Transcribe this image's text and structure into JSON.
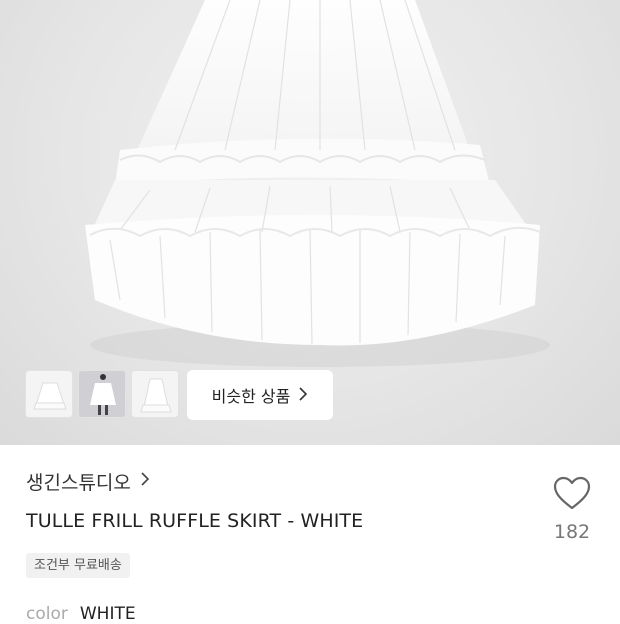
{
  "product_image": {
    "description_icon": "skirt-image"
  },
  "thumbnails": [
    {
      "name": "thumbnail-1",
      "selected": false
    },
    {
      "name": "thumbnail-2",
      "selected": true
    },
    {
      "name": "thumbnail-3",
      "selected": false
    }
  ],
  "similar_button": {
    "label": "비슷한 상품",
    "icon": "chevron-right-icon"
  },
  "brand": {
    "name": "생긴스튜디오",
    "icon": "chevron-right-icon"
  },
  "product": {
    "title": "TULLE FRILL RUFFLE SKIRT - WHITE",
    "shipping_badge": "조건부 무료배송"
  },
  "like": {
    "icon": "heart-icon",
    "count": "182"
  },
  "options": {
    "color_label": "color",
    "color_value": "WHITE"
  }
}
